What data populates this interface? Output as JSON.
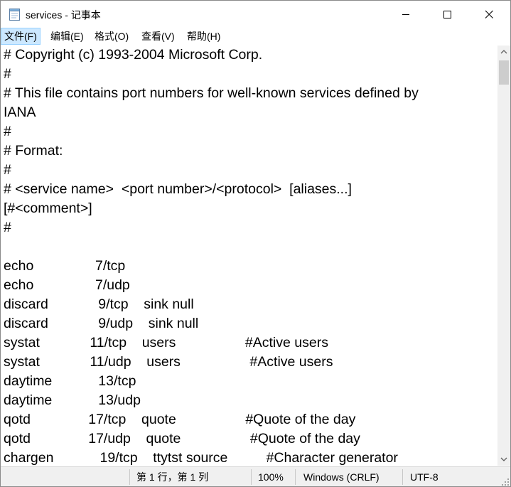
{
  "titlebar": {
    "title": "services - 记事本",
    "minimize_icon": "minimize-icon",
    "maximize_icon": "maximize-icon",
    "close_icon": "close-icon"
  },
  "menu": [
    {
      "label": "文件(F)"
    },
    {
      "label": "编辑(E)"
    },
    {
      "label": "格式(O)"
    },
    {
      "label": "查看(V)"
    },
    {
      "label": "帮助(H)"
    }
  ],
  "editor": {
    "lines": [
      "# Copyright (c) 1993-2004 Microsoft Corp.",
      "#",
      "# This file contains port numbers for well-known services defined by",
      "IANA",
      "#",
      "# Format:",
      "#",
      "# <service name>  <port number>/<protocol>  [aliases...]",
      "[#<comment>]",
      "#",
      "",
      "echo                7/tcp",
      "echo                7/udp",
      "discard             9/tcp    sink null",
      "discard             9/udp    sink null",
      "systat             11/tcp    users                  #Active users",
      "systat             11/udp    users                  #Active users",
      "daytime            13/tcp",
      "daytime            13/udp",
      "qotd               17/tcp    quote                  #Quote of the day",
      "qotd               17/udp    quote                  #Quote of the day",
      "chargen            19/tcp    ttytst source          #Character generator"
    ]
  },
  "statusbar": {
    "position": "第 1 行，第 1 列",
    "zoom": "100%",
    "line_ending": "Windows (CRLF)",
    "encoding": "UTF-8"
  }
}
